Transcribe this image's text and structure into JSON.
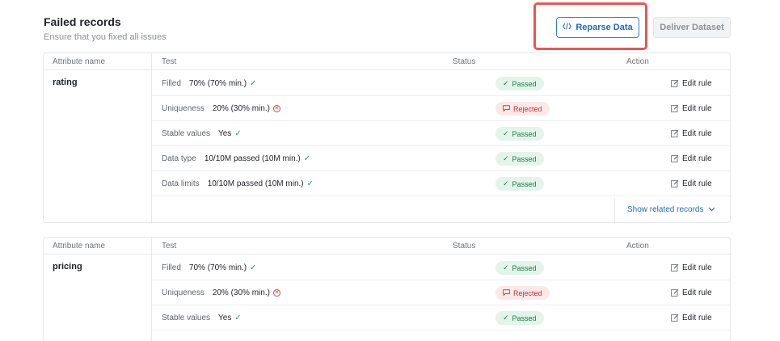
{
  "header": {
    "title": "Failed records",
    "subtitle": "Ensure that you fixed all issues"
  },
  "buttons": {
    "reparse_label": "Reparse Data",
    "deliver_label": "Deliver Dataset"
  },
  "columns": {
    "attribute": "Attribute name",
    "test": "Test",
    "status": "Status",
    "action": "Action"
  },
  "groups": [
    {
      "attribute": "rating",
      "rows": [
        {
          "name": "Filled",
          "value": "70% (70% min.)",
          "result": "pass",
          "status": "Passed",
          "action": "Edit rule"
        },
        {
          "name": "Uniqueness",
          "value": "20% (30% min.)",
          "result": "fail",
          "status": "Rejected",
          "action": "Edit rule"
        },
        {
          "name": "Stable values",
          "value": "Yes",
          "result": "pass",
          "status": "Passed",
          "action": "Edit rule"
        },
        {
          "name": "Data type",
          "value": "10/10M passed (10M min.)",
          "result": "pass",
          "status": "Passed",
          "action": "Edit rule"
        },
        {
          "name": "Data limits",
          "value": "10/10M passed (10M min.)",
          "result": "pass",
          "status": "Passed",
          "action": "Edit rule"
        }
      ],
      "footer_link": "Show related records"
    },
    {
      "attribute": "pricing",
      "rows": [
        {
          "name": "Filled",
          "value": "70% (70% min.)",
          "result": "pass",
          "status": "Passed",
          "action": "Edit rule"
        },
        {
          "name": "Uniqueness",
          "value": "20% (30% min.)",
          "result": "fail",
          "status": "Rejected",
          "action": "Edit rule"
        },
        {
          "name": "Stable values",
          "value": "Yes",
          "result": "pass",
          "status": "Passed",
          "action": "Edit rule"
        }
      ]
    }
  ],
  "colors": {
    "accent": "#2568c4",
    "highlight": "#ef5350",
    "passed_bg": "#e3f5ea",
    "passed_text": "#1f7a4a",
    "rejected_bg": "#fde8e8",
    "rejected_text": "#c53030"
  },
  "icons": {
    "reparse": "code-icon",
    "pass": "check-icon",
    "fail": "x-circle-icon",
    "rejected": "message-icon",
    "edit": "edit-icon",
    "expand": "chevron-down-icon"
  }
}
